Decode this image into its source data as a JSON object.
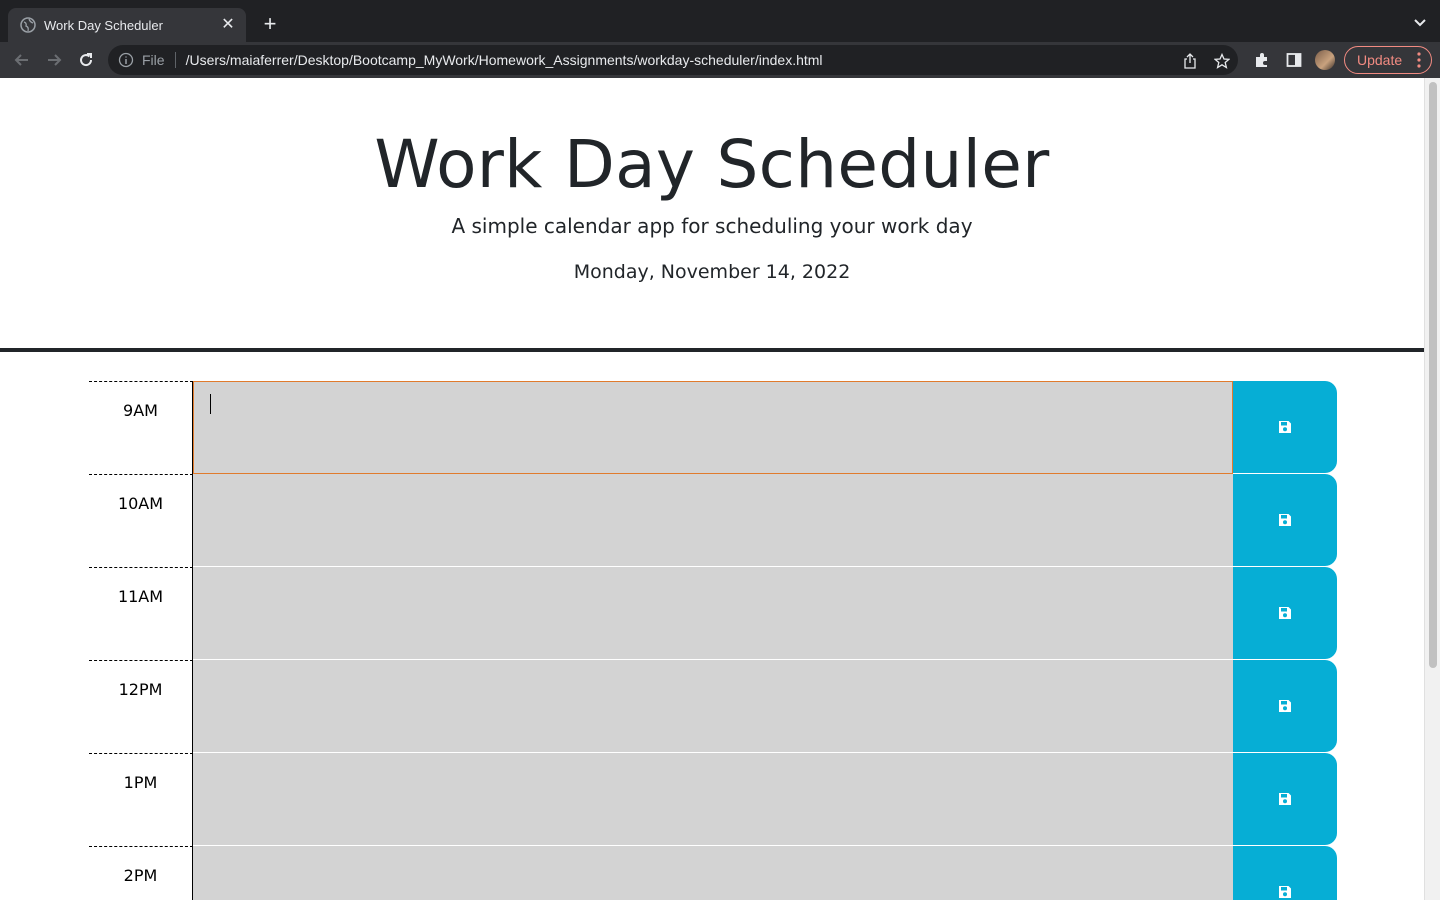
{
  "browser": {
    "tab_title": "Work Day Scheduler",
    "tab_close": "✕",
    "new_tab": "+",
    "scheme_label": "File",
    "url": "/Users/maiaferrer/Desktop/Bootcamp_MyWork/Homework_Assignments/workday-scheduler/index.html",
    "update_label": "Update"
  },
  "header": {
    "title": "Work Day Scheduler",
    "subtitle": "A simple calendar app for scheduling your work day",
    "current_day": "Monday, November 14, 2022"
  },
  "schedule": {
    "hours": [
      {
        "label": "9AM",
        "text": "",
        "focused": true
      },
      {
        "label": "10AM",
        "text": ""
      },
      {
        "label": "11AM",
        "text": ""
      },
      {
        "label": "12PM",
        "text": ""
      },
      {
        "label": "1PM",
        "text": ""
      },
      {
        "label": "2PM",
        "text": ""
      }
    ],
    "save_icon": "floppy-disk-icon"
  },
  "colors": {
    "save_button": "#06aed5",
    "textarea_bg": "#d3d3d3",
    "focus_border": "#e07b2d",
    "text": "#212529"
  }
}
